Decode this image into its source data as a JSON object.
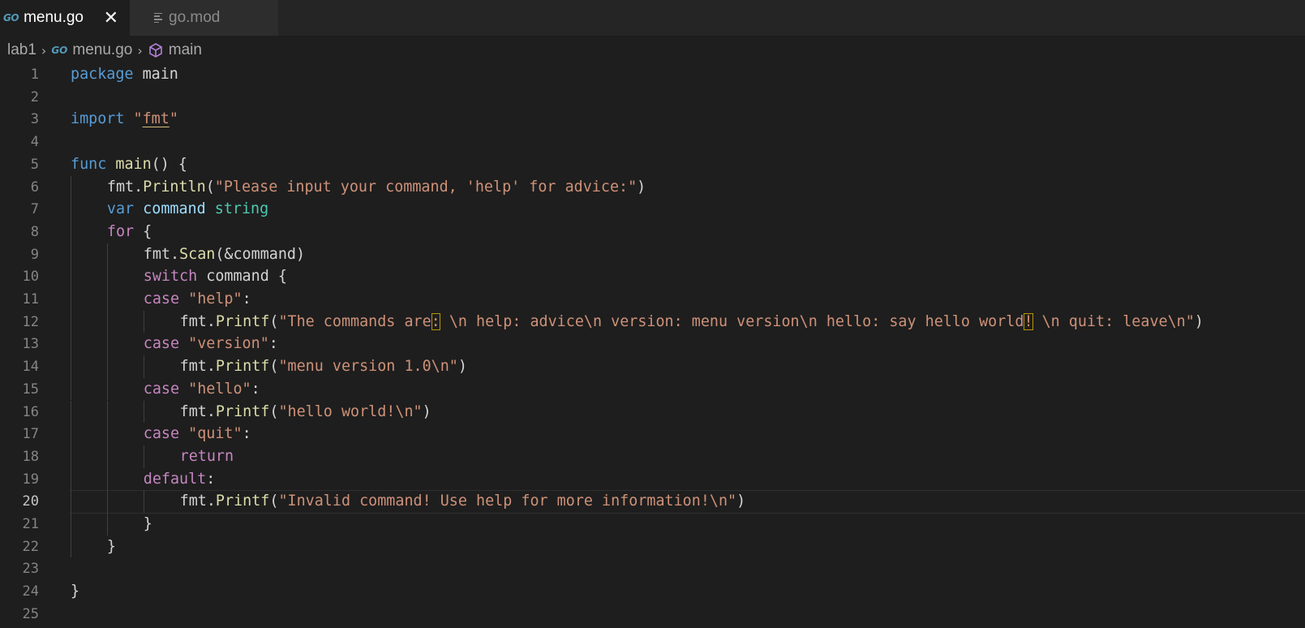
{
  "tabs": [
    {
      "label": "menu.go",
      "icon": "go-file-icon",
      "active": true
    },
    {
      "label": "go.mod",
      "icon": "file-lines-icon",
      "active": false
    }
  ],
  "tab_icon_text": "GO",
  "close_glyph": "✕",
  "breadcrumb": {
    "folder": "lab1",
    "file": "menu.go",
    "symbol": "main"
  },
  "editor": {
    "current_line": 20,
    "colors": {
      "background": "#1e1e1e",
      "keyword": "#569cd6",
      "control": "#c586c0",
      "function": "#dcdcaa",
      "string": "#ce9178",
      "variable": "#9cdcfe",
      "type": "#4ec9b0"
    },
    "lines": [
      {
        "n": "1",
        "indent": 0,
        "tokens": [
          [
            "kw",
            "package"
          ],
          [
            "p",
            " main"
          ]
        ]
      },
      {
        "n": "2",
        "indent": 0,
        "tokens": []
      },
      {
        "n": "3",
        "indent": 0,
        "tokens": [
          [
            "kw",
            "import"
          ],
          [
            "p",
            " "
          ],
          [
            "str",
            "\""
          ],
          [
            "strU",
            "fmt"
          ],
          [
            "str",
            "\""
          ]
        ]
      },
      {
        "n": "4",
        "indent": 0,
        "tokens": []
      },
      {
        "n": "5",
        "indent": 0,
        "tokens": [
          [
            "kw",
            "func"
          ],
          [
            "p",
            " "
          ],
          [
            "fn",
            "main"
          ],
          [
            "p",
            "() {"
          ]
        ]
      },
      {
        "n": "6",
        "indent": 1,
        "tokens": [
          [
            "p",
            "fmt."
          ],
          [
            "fn",
            "Println"
          ],
          [
            "p",
            "("
          ],
          [
            "str",
            "\"Please input your command, 'help' for advice:\""
          ],
          [
            "p",
            ")"
          ]
        ]
      },
      {
        "n": "7",
        "indent": 1,
        "tokens": [
          [
            "kw",
            "var"
          ],
          [
            "p",
            " "
          ],
          [
            "var",
            "command"
          ],
          [
            "p",
            " "
          ],
          [
            "type",
            "string"
          ]
        ]
      },
      {
        "n": "8",
        "indent": 1,
        "tokens": [
          [
            "ctl",
            "for"
          ],
          [
            "p",
            " {"
          ]
        ]
      },
      {
        "n": "9",
        "indent": 2,
        "tokens": [
          [
            "p",
            "fmt."
          ],
          [
            "fn",
            "Scan"
          ],
          [
            "p",
            "(&command)"
          ]
        ]
      },
      {
        "n": "10",
        "indent": 2,
        "tokens": [
          [
            "ctl",
            "switch"
          ],
          [
            "p",
            " command {"
          ]
        ]
      },
      {
        "n": "11",
        "indent": 2,
        "tokens": [
          [
            "ctl",
            "case"
          ],
          [
            "p",
            " "
          ],
          [
            "str",
            "\"help\""
          ],
          [
            "p",
            ":"
          ]
        ]
      },
      {
        "n": "12",
        "indent": 3,
        "tokens": [
          [
            "p",
            "fmt."
          ],
          [
            "fn",
            "Printf"
          ],
          [
            "p",
            "("
          ],
          [
            "str",
            "\"The commands are"
          ],
          [
            "strB",
            ":"
          ],
          [
            "str",
            " \\n help: advice\\n version: menu version\\n hello: say hello world"
          ],
          [
            "strB",
            "!"
          ],
          [
            "str",
            " \\n quit: leave\\n\""
          ],
          [
            "p",
            ")"
          ]
        ]
      },
      {
        "n": "13",
        "indent": 2,
        "tokens": [
          [
            "ctl",
            "case"
          ],
          [
            "p",
            " "
          ],
          [
            "str",
            "\"version\""
          ],
          [
            "p",
            ":"
          ]
        ]
      },
      {
        "n": "14",
        "indent": 3,
        "tokens": [
          [
            "p",
            "fmt."
          ],
          [
            "fn",
            "Printf"
          ],
          [
            "p",
            "("
          ],
          [
            "str",
            "\"menu version 1.0\\n\""
          ],
          [
            "p",
            ")"
          ]
        ]
      },
      {
        "n": "15",
        "indent": 2,
        "tokens": [
          [
            "ctl",
            "case"
          ],
          [
            "p",
            " "
          ],
          [
            "str",
            "\"hello\""
          ],
          [
            "p",
            ":"
          ]
        ]
      },
      {
        "n": "16",
        "indent": 3,
        "tokens": [
          [
            "p",
            "fmt."
          ],
          [
            "fn",
            "Printf"
          ],
          [
            "p",
            "("
          ],
          [
            "str",
            "\"hello world!\\n\""
          ],
          [
            "p",
            ")"
          ]
        ]
      },
      {
        "n": "17",
        "indent": 2,
        "tokens": [
          [
            "ctl",
            "case"
          ],
          [
            "p",
            " "
          ],
          [
            "str",
            "\"quit\""
          ],
          [
            "p",
            ":"
          ]
        ]
      },
      {
        "n": "18",
        "indent": 3,
        "tokens": [
          [
            "ctl",
            "return"
          ]
        ]
      },
      {
        "n": "19",
        "indent": 2,
        "tokens": [
          [
            "ctl",
            "default"
          ],
          [
            "p",
            ":"
          ]
        ]
      },
      {
        "n": "20",
        "indent": 3,
        "tokens": [
          [
            "p",
            "fmt."
          ],
          [
            "fn",
            "Printf"
          ],
          [
            "p",
            "("
          ],
          [
            "str",
            "\"Invalid command! Use help for more information!\\n\""
          ],
          [
            "p",
            ")"
          ]
        ]
      },
      {
        "n": "21",
        "indent": 2,
        "tokens": [
          [
            "p",
            "}"
          ]
        ]
      },
      {
        "n": "22",
        "indent": 1,
        "tokens": [
          [
            "p",
            "}"
          ]
        ]
      },
      {
        "n": "23",
        "indent": 0,
        "tokens": []
      },
      {
        "n": "24",
        "indent": 0,
        "tokens": [
          [
            "p",
            "}"
          ]
        ]
      },
      {
        "n": "25",
        "indent": 0,
        "tokens": []
      }
    ]
  }
}
